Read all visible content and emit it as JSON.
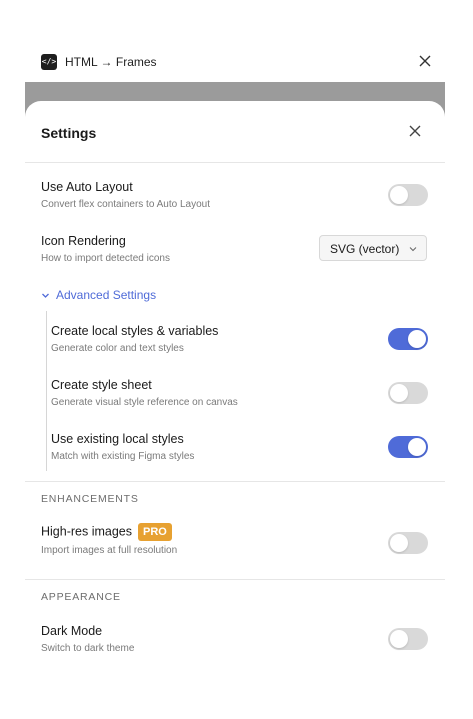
{
  "window": {
    "plugin_icon_text": "</>",
    "plugin_title": "HTML → Frames"
  },
  "settings": {
    "title": "Settings",
    "rows": {
      "auto_layout": {
        "title": "Use Auto Layout",
        "desc": "Convert flex containers to Auto Layout",
        "enabled": false
      },
      "icon_rendering": {
        "title": "Icon Rendering",
        "desc": "How to import detected icons",
        "selected": "SVG (vector)"
      },
      "local_styles": {
        "title": "Create local styles & variables",
        "desc": "Generate color and text styles",
        "enabled": true
      },
      "style_sheet": {
        "title": "Create style sheet",
        "desc": "Generate visual style reference on canvas",
        "enabled": false
      },
      "existing_styles": {
        "title": "Use existing local styles",
        "desc": "Match with existing Figma styles",
        "enabled": true
      },
      "highres": {
        "title": "High-res images",
        "badge": "PRO",
        "desc": "Import images at full resolution",
        "enabled": false
      },
      "dark_mode": {
        "title": "Dark Mode",
        "desc": "Switch to dark theme",
        "enabled": false
      }
    },
    "advanced_label": "Advanced Settings",
    "sections": {
      "enhancements": "ENHANCEMENTS",
      "appearance": "APPEARANCE"
    }
  },
  "colors": {
    "accent": "#4f6bd8",
    "pro_badge": "#e7a131",
    "toggle_off": "#d9d9d9"
  },
  "icons": {
    "plugin": "code-icon",
    "close": "close-icon",
    "chevron": "chevron-down-icon"
  }
}
